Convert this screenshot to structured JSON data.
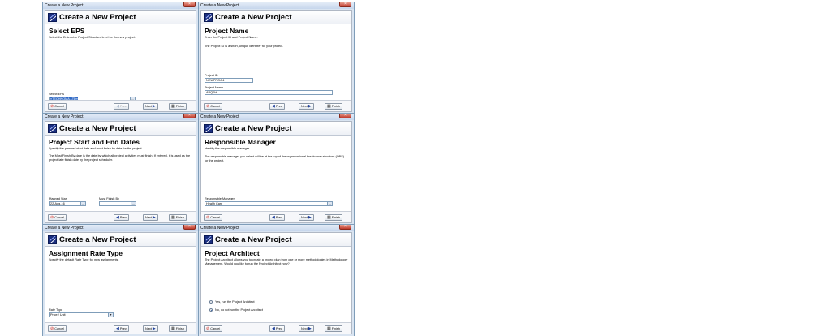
{
  "window_title": "Create a New Project",
  "close_glyph": "×",
  "banner_title": "Create a New Project",
  "buttons": {
    "cancel": "Cancel",
    "prev": "Prev",
    "next": "Next",
    "finish": "Finish"
  },
  "icons": {
    "cancel": "cancel-icon",
    "prev": "arrow-left-icon",
    "next": "arrow-right-icon",
    "finish": "checkered-flag-icon"
  },
  "colors": {
    "selection": "#316ac5",
    "logo": "#1b2f80",
    "cancel_icon": "#d12a1f"
  },
  "dialogs": {
    "eps": {
      "step_title": "Select EPS",
      "description": "Select the Enterprise Project Structure level for the new project.",
      "field_label": "Select EPS",
      "field_value": "«TECHNOMA.LTD»"
    },
    "name": {
      "step_title": "Project Name",
      "description_1": "Enter the Project ID and Project Name.",
      "description_2": "The Project ID is a short, unique identifier for your project.",
      "id_label": "Project ID",
      "id_value": "NEWPROJ-4",
      "name_label": "Project Name",
      "name_value": "APQFH"
    },
    "dates": {
      "step_title": "Project Start and End Dates",
      "description_1": "Specify the planned start date and must finish by date for the project.",
      "description_2": "The Must Finish By date is the date by which all project activities must finish.  If entered, it is used as the project late finish date by the project scheduler.",
      "start_label": "Planned Start",
      "start_value": "22-Aug-16",
      "finish_label": "Must Finish By",
      "finish_value": ""
    },
    "manager": {
      "step_title": "Responsible Manager",
      "description_1": "Identify the responsible manager.",
      "description_2": "The responsible manager you select will be at the top of the organizational breakdown structure (OBS) for the project.",
      "field_label": "Responsible Manager",
      "field_value": "Health Care"
    },
    "rate": {
      "step_title": "Assignment Rate Type",
      "description": "Specify the default Rate Type for new assignments.",
      "field_label": "Rate Type",
      "field_value": "Price / Unit"
    },
    "architect": {
      "step_title": "Project Architect",
      "description": "The Project Architect allows you to create a project plan from one or more methodologies in Methodology Management.   Would you like to run the Project Architect now?",
      "option_yes": "Yes, run the Project Architect",
      "option_no": "No, do not run the Project Architect"
    }
  }
}
